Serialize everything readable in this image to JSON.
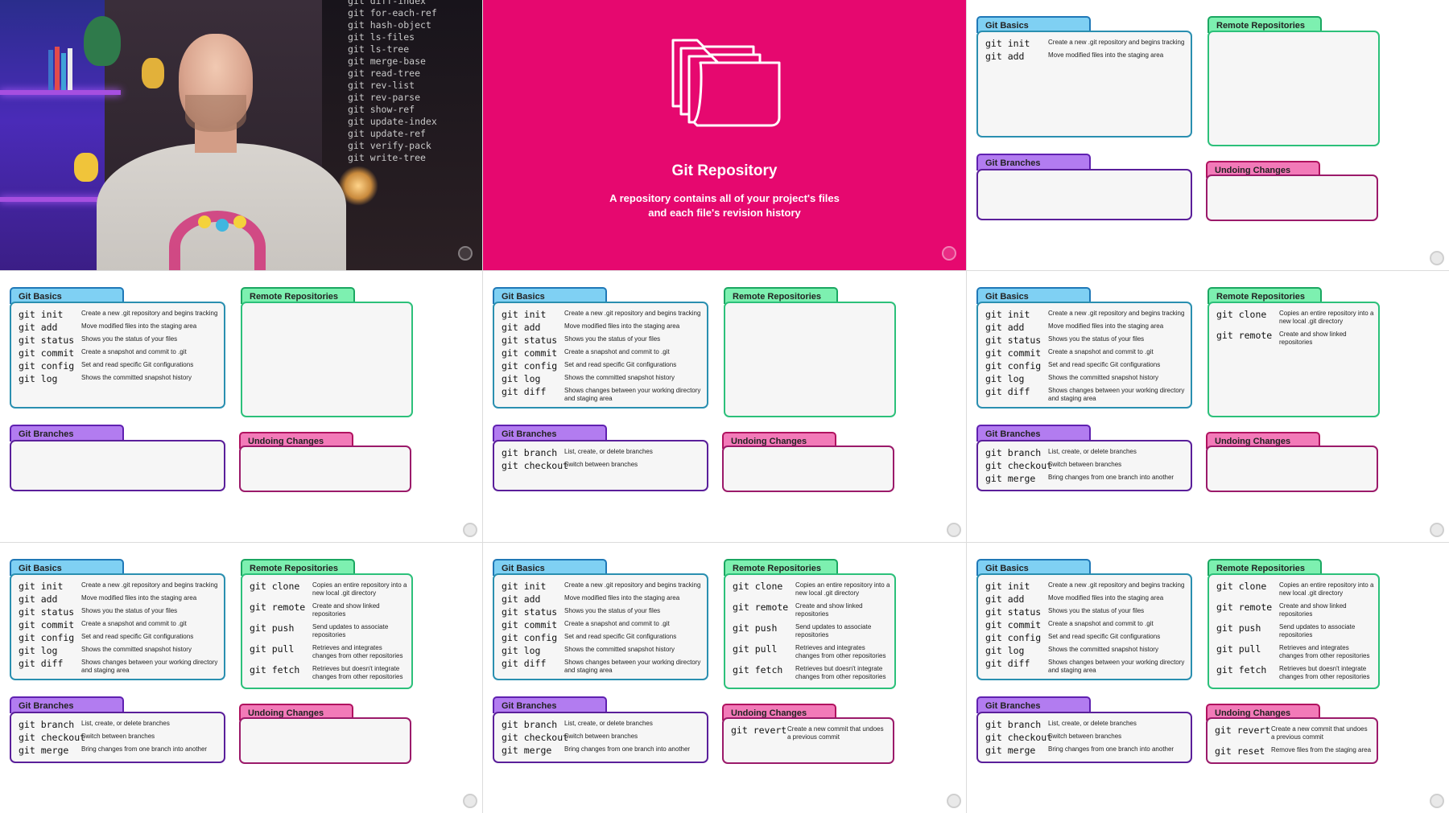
{
  "video": {
    "commands": [
      "git diff-index",
      "git for-each-ref",
      "git hash-object",
      "git ls-files",
      "git ls-tree",
      "git merge-base",
      "git read-tree",
      "git rev-list",
      "git rev-parse",
      "git show-ref",
      "git update-index",
      "git update-ref",
      "git verify-pack",
      "git write-tree"
    ]
  },
  "title_slide": {
    "title": "Git Repository",
    "subtitle_line1": "A repository contains all of your project's files",
    "subtitle_line2": "and each file's revision history"
  },
  "panels": {
    "basics": "Git Basics",
    "remote": "Remote Repositories",
    "branches": "Git Branches",
    "undo": "Undoing Changes"
  },
  "commands": {
    "init": {
      "cmd": "git init",
      "desc": "Create a new .git repository and begins tracking"
    },
    "add": {
      "cmd": "git add",
      "desc": "Move modified files into the staging area"
    },
    "status": {
      "cmd": "git status",
      "desc": "Shows you the status of your files"
    },
    "commit": {
      "cmd": "git commit",
      "desc": "Create a snapshot and commit to .git"
    },
    "config": {
      "cmd": "git config",
      "desc": "Set and read specific Git configurations"
    },
    "log": {
      "cmd": "git log",
      "desc": "Shows the committed snapshot history"
    },
    "diff": {
      "cmd": "git diff",
      "desc": "Shows changes between your working directory and staging area"
    },
    "clone": {
      "cmd": "git clone",
      "desc": "Copies an entire repository into a new local .git directory"
    },
    "remote": {
      "cmd": "git remote",
      "desc": "Create and show linked repositories"
    },
    "push": {
      "cmd": "git push",
      "desc": "Send updates to associate repositories"
    },
    "pull": {
      "cmd": "git pull",
      "desc": "Retrieves and integrates changes from other repositories"
    },
    "fetch": {
      "cmd": "git fetch",
      "desc": "Retrieves but doesn't integrate changes from other repositories"
    },
    "branch": {
      "cmd": "git branch",
      "desc": "List, create, or delete branches"
    },
    "checkout": {
      "cmd": "git checkout",
      "desc": "Switch between branches"
    },
    "merge": {
      "cmd": "git merge",
      "desc": "Bring changes from one branch into another"
    },
    "revert": {
      "cmd": "git revert",
      "desc": "Create a new commit that undoes a previous commit"
    },
    "reset": {
      "cmd": "git reset",
      "desc": "Remove files from the staging area"
    }
  },
  "slides": [
    {
      "basics": [
        "init",
        "add"
      ],
      "remote": [],
      "branches": [],
      "undo": []
    },
    {
      "basics": [
        "init",
        "add",
        "status",
        "commit",
        "config",
        "log"
      ],
      "remote": [],
      "branches": [],
      "undo": []
    },
    {
      "basics": [
        "init",
        "add",
        "status",
        "commit",
        "config",
        "log",
        "diff"
      ],
      "remote": [],
      "branches": [
        "branch",
        "checkout"
      ],
      "undo": []
    },
    {
      "basics": [
        "init",
        "add",
        "status",
        "commit",
        "config",
        "log",
        "diff"
      ],
      "remote": [
        "clone",
        "remote"
      ],
      "branches": [
        "branch",
        "checkout",
        "merge"
      ],
      "undo": []
    },
    {
      "basics": [
        "init",
        "add",
        "status",
        "commit",
        "config",
        "log",
        "diff"
      ],
      "remote": [
        "clone",
        "remote",
        "push",
        "pull",
        "fetch"
      ],
      "branches": [
        "branch",
        "checkout",
        "merge"
      ],
      "undo": []
    },
    {
      "basics": [
        "init",
        "add",
        "status",
        "commit",
        "config",
        "log",
        "diff"
      ],
      "remote": [
        "clone",
        "remote",
        "push",
        "pull",
        "fetch"
      ],
      "branches": [
        "branch",
        "checkout",
        "merge"
      ],
      "undo": [
        "revert"
      ]
    },
    {
      "basics": [
        "init",
        "add",
        "status",
        "commit",
        "config",
        "log",
        "diff"
      ],
      "remote": [
        "clone",
        "remote",
        "push",
        "pull",
        "fetch"
      ],
      "branches": [
        "branch",
        "checkout",
        "merge"
      ],
      "undo": [
        "revert",
        "reset"
      ]
    }
  ]
}
